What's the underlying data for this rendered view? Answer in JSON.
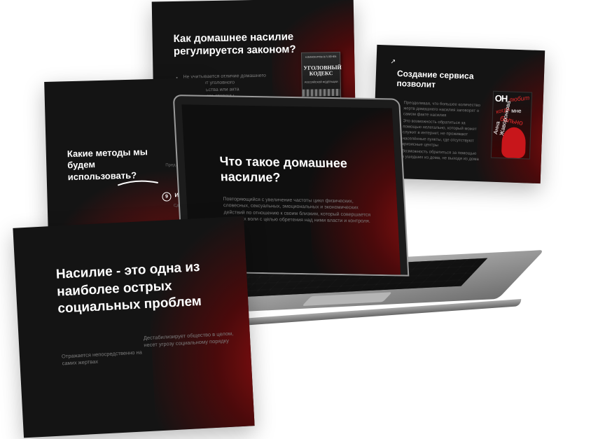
{
  "slides": {
    "law": {
      "title": "Как домашнее насилие регулируется законом?",
      "bullet": "Не учитывается отличие домашнего насилия от уголовного посягательства или акта агрессивного стороны",
      "book": {
        "top": "А.ВИНОКУРОВ В.П.ЛЕНЕВ",
        "title": "УГОЛОВНЫЙ КОДЕКС",
        "subtitle": "РОССИЙСКОЙ ФЕДЕРАЦИИ"
      }
    },
    "service": {
      "title": "Создание сервиса позволит",
      "scribble": "↗",
      "bullets": [
        "Преодолевая, что большее количество жертв домашнего насилия заговорят о самом факте насилия",
        "Это возможность обратиться за помощью нелегально, который может служит в интернет, не проживают населённые пункты, где отсутствуют кризисные центры",
        "Возможность обратиться за помощью в ушедших из дома, не выходя из дома"
      ],
      "poster": {
        "part1": "ОН",
        "part2": "любит",
        "part3": "когда",
        "part4": "мне",
        "part5": "больно",
        "author": "Анна Жаворонкова"
      }
    },
    "methods": {
      "title": "Какие методы мы будем использовать?",
      "badge": "9",
      "label": "Ин",
      "muted_top": "Пред…",
      "muted_bottom": "Сде…"
    },
    "laptop_screen": {
      "title": "Что такое домашнее насилие?",
      "body": "Повторяющийся с увеличение частоты цикл физических, словесных, сексуальных, эмоциональных и экономических действий по отношению к своим близким, который совершается против их воли с целью обретения над ними власти и контроля."
    },
    "violence": {
      "title": "Насилие - это одна из наиболее острых социальных проблем",
      "left": "Отражается непосредственно на самих жертвах",
      "right": "Дестабилизирует общество в целом, несет угрозу социальному порядку"
    }
  },
  "colors": {
    "slide_bg": "#141414",
    "accent_red": "#8a0f10",
    "text_white": "#ffffff",
    "text_muted": "#7b7b7b"
  }
}
